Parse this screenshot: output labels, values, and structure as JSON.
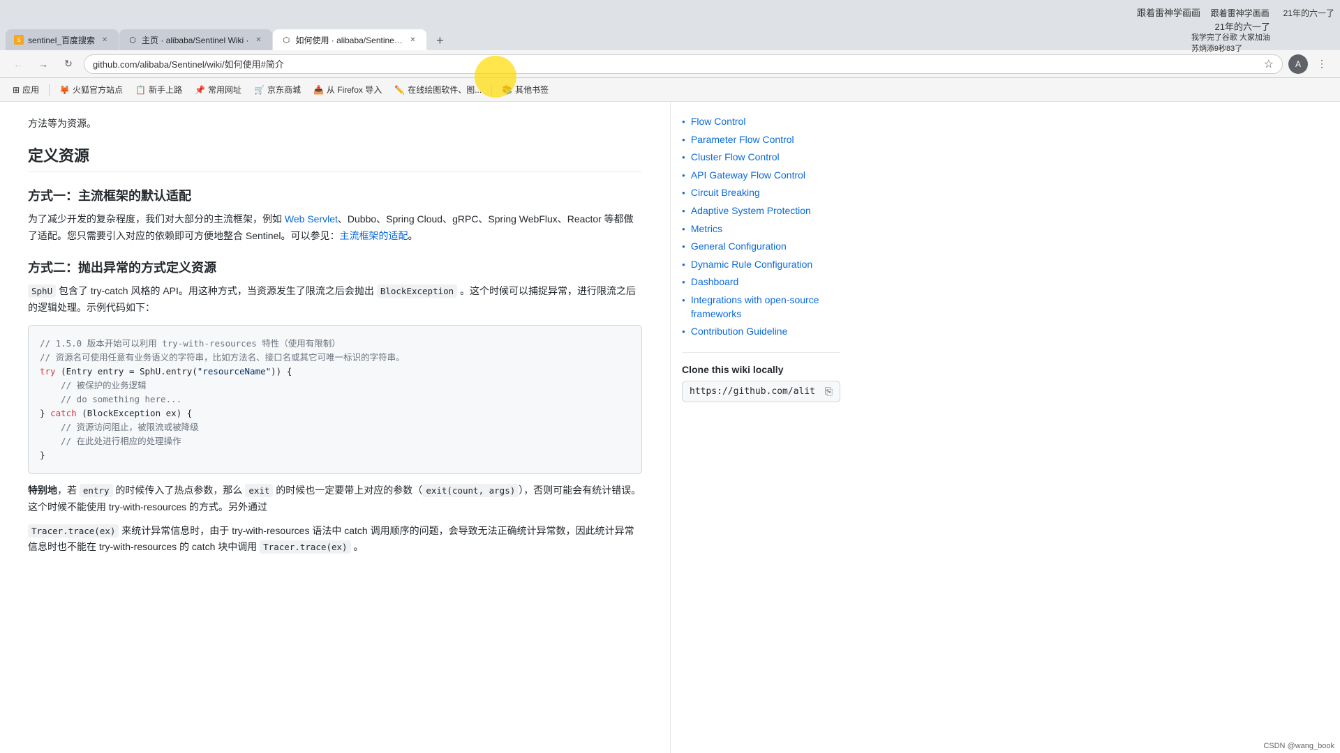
{
  "watermarks": {
    "top_center": "跟着雷神学画画",
    "top_right": "21年的六一了",
    "sub1": "我学完了谷歌 大家加油",
    "sub2": "苏炳添9秒83了",
    "bottom": "CSDN @wang_book"
  },
  "browser": {
    "tabs": [
      {
        "id": "tab1",
        "favicon_color": "#f80",
        "favicon_symbol": "S",
        "title": "sentinel_百度搜索",
        "active": false,
        "url": ""
      },
      {
        "id": "tab2",
        "favicon_symbol": "⬡",
        "title": "主页 · alibaba/Sentinel Wiki ·",
        "active": false,
        "url": ""
      },
      {
        "id": "tab3",
        "favicon_symbol": "⬡",
        "title": "如何使用 · alibaba/Sentinel Wi...",
        "active": true,
        "url": "github.com/alibaba/Sentinel/wiki/如何使用#简介"
      }
    ],
    "address_url": "github.com/alibaba/Sentinel/wiki/如何使用#简介",
    "extensions": [
      {
        "label": "应用"
      },
      {
        "label": "火狐官方站点"
      },
      {
        "label": "新手上路"
      },
      {
        "label": "常用网址"
      },
      {
        "label": "京东商城"
      },
      {
        "label": "从 Firefox 导入"
      },
      {
        "label": "在线绘图软件、图..."
      },
      {
        "label": "其他书签"
      }
    ]
  },
  "article": {
    "intro": "方法等为资源。",
    "heading1": "定义资源",
    "subheading1": "方式一：主流框架的默认适配",
    "para1": "为了减少开发的复杂程度，我们对大部分的主流框架，例如 Web Servlet、Dubbo、Spring Cloud、gRPC、Spring WebFlux、Reactor 等都做了适配。您只需要引入对应的依赖即可方便地整合 Sentinel。可以参见：",
    "link1": "主流框架的适配",
    "subheading2": "方式二：抛出异常的方式定义资源",
    "para2": "SphU 包含了 try-catch 风格的 API。用这种方式，当资源发生了限流之后会抛出 BlockException 。这个时候可以捕捉异常，进行限流之后的逻辑处理。示例代码如下：",
    "code": [
      "// 1.5.0 版本开始可以利用 try-with-resources 特性（使用有限制）",
      "// 资源名可使用任意有业务语义的字符串，比如方法名、接口名或其它可唯一标识的字符串。",
      "try (Entry entry = SphU.entry(\"resourceName\")) {",
      "    // 被保护的业务逻辑",
      "    // do something here...",
      "} catch (BlockException ex) {",
      "    // 资源访问阻止，被限流或被降级",
      "    // 在此处进行相应的处理操作",
      "}"
    ],
    "special_heading": "特别地",
    "special_para": "，若 entry 的时候传入了热点参数，那么 exit 的时候也一定要带上对应的参数（exit(count, args)），否则可能会有统计错误。这个时候不能使用 try-with-resources 的方式。另外通过 Tracer.trace(ex) 来统计异常信息时，由于 try-with-resources 语法中 catch 调用顺序的问题，会导致无法正确统计异常数，因此统计异常信息时也不能在 try-with-resources 的 catch 块中调用 Tracer.trace(ex) 。"
  },
  "sidebar": {
    "items": [
      {
        "label": "Flow Control"
      },
      {
        "label": "Parameter Flow Control"
      },
      {
        "label": "Cluster Flow Control"
      },
      {
        "label": "API Gateway Flow Control"
      },
      {
        "label": "Circuit Breaking"
      },
      {
        "label": "Adaptive System Protection"
      },
      {
        "label": "Metrics"
      },
      {
        "label": "General Configuration"
      },
      {
        "label": "Dynamic Rule Configuration"
      },
      {
        "label": "Dashboard"
      },
      {
        "label": "Integrations with open-source frameworks"
      },
      {
        "label": "Contribution Guideline"
      }
    ],
    "clone_section": {
      "title": "Clone this wiki locally",
      "url": "https://github.com/alit"
    }
  }
}
